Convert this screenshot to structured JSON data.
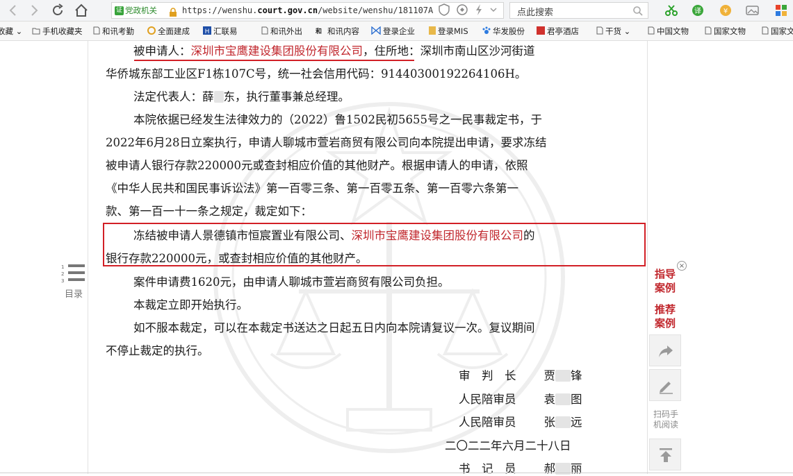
{
  "browser": {
    "gov_badge": "党政机关",
    "url_prefix": "https://wenshu.",
    "url_domain": "court.gov.cn",
    "url_rest": "/website/wenshu/181107A",
    "search_label": "点此搜索"
  },
  "bookmarks": [
    "收藏",
    "手机收藏夹",
    "和讯考勤",
    "全面建成",
    "汇联易",
    "和讯外出",
    "和讯内容",
    "登录企业",
    "登录MIS",
    "华发股份",
    "君亭酒店",
    "干货",
    "中国文物",
    "国家文物",
    "国家文"
  ],
  "document": {
    "l1_prefix": "被申请人：",
    "l1_company": "深圳市宝鹰建设集团股份有限公司",
    "l1_suffix": "，住所地：深圳市南山区沙河街道",
    "l2": "华侨城东部工业区F1栋107C号，统一社会信用代码：91440300192264106H。",
    "l3_a": "法定代表人：薛",
    "l3_b": "东，执行董事兼总经理。",
    "l4": "本院依据已经发生法律效力的（2022）鲁1502民初5655号之一民事裁定书，于",
    "l5": "2022年6月28日立案执行，申请人聊城市萱岩商贸有限公司向本院提出申请，要求冻结",
    "l6": "被申请人银行存款220000元或查封相应价值的其他财产。根据申请人的申请，依照",
    "l7": "《中华人民共和国民事诉讼法》第一百零三条、第一百零五条、第一百零六条第一",
    "l8": "款、第一百一十一条之规定，裁定如下：",
    "l9_prefix": "冻结被申请人景德镇市恒宸置业有限公司、",
    "l9_company": "深圳市宝鹰建设集团股份有限公司",
    "l9_suffix": "的",
    "l10": "银行存款220000元，或查封相应价值的其他财产。",
    "l11": "案件申请费1620元，由申请人聊城市萱岩商贸有限公司负担。",
    "l12": "本裁定立即开始执行。",
    "l13": "如不服本裁定，可以在本裁定书送达之日起五日内向本院请复议一次。复议期间",
    "l14": "不停止裁定的执行。"
  },
  "signature": {
    "r1_role": "审　判　长",
    "r1_name_a": "贾",
    "r1_name_b": "锋",
    "r2_role": "人民陪审员",
    "r2_name_a": "袁",
    "r2_name_b": "图",
    "r3_role": "人民陪审员",
    "r3_name_a": "张",
    "r3_name_b": "远",
    "date": "二〇二二年六月二十八日",
    "r5_role": "书　记　员",
    "r5_name_a": "郝",
    "r5_name_b": "丽"
  },
  "toc_label": "目录",
  "side": {
    "guide_1": "指导",
    "guide_2": "案例",
    "recommend_1": "推荐",
    "recommend_2": "案例",
    "scan_1": "扫码手",
    "scan_2": "机阅读"
  },
  "colors": {
    "highlight": "#c1272d",
    "annotation": "#d21f26"
  }
}
